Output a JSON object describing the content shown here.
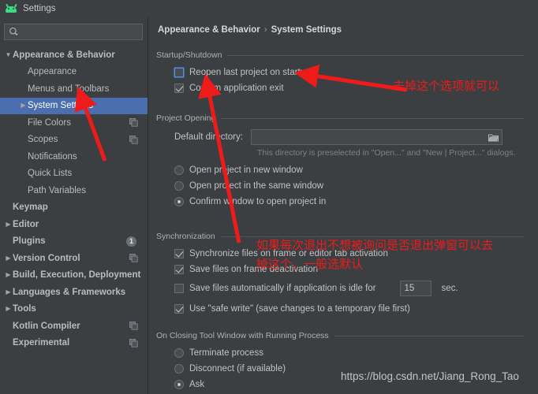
{
  "window": {
    "title": "Settings",
    "app_icon": "android-icon"
  },
  "sidebar": {
    "search": {
      "value": "",
      "placeholder": "",
      "icon": "search-icon"
    },
    "items": [
      {
        "label": "Appearance & Behavior",
        "arrow": "▼",
        "level": 0,
        "bold": true,
        "selected": false,
        "badge": null
      },
      {
        "label": "Appearance",
        "arrow": "",
        "level": 1,
        "bold": false,
        "selected": false,
        "badge": null
      },
      {
        "label": "Menus and Toolbars",
        "arrow": "",
        "level": 1,
        "bold": false,
        "selected": false,
        "badge": null
      },
      {
        "label": "System Settings",
        "arrow": "▶",
        "level": 1,
        "bold": false,
        "selected": true,
        "badge": null
      },
      {
        "label": "File Colors",
        "arrow": "",
        "level": 1,
        "bold": false,
        "selected": false,
        "badge": "copy"
      },
      {
        "label": "Scopes",
        "arrow": "",
        "level": 1,
        "bold": false,
        "selected": false,
        "badge": "copy"
      },
      {
        "label": "Notifications",
        "arrow": "",
        "level": 1,
        "bold": false,
        "selected": false,
        "badge": null
      },
      {
        "label": "Quick Lists",
        "arrow": "",
        "level": 1,
        "bold": false,
        "selected": false,
        "badge": null
      },
      {
        "label": "Path Variables",
        "arrow": "",
        "level": 1,
        "bold": false,
        "selected": false,
        "badge": null
      },
      {
        "label": "Keymap",
        "arrow": "",
        "level": 0,
        "bold": true,
        "selected": false,
        "badge": null
      },
      {
        "label": "Editor",
        "arrow": "▶",
        "level": 0,
        "bold": true,
        "selected": false,
        "badge": null
      },
      {
        "label": "Plugins",
        "arrow": "",
        "level": 0,
        "bold": true,
        "selected": false,
        "badge": "1"
      },
      {
        "label": "Version Control",
        "arrow": "▶",
        "level": 0,
        "bold": true,
        "selected": false,
        "badge": "copy"
      },
      {
        "label": "Build, Execution, Deployment",
        "arrow": "▶",
        "level": 0,
        "bold": true,
        "selected": false,
        "badge": null
      },
      {
        "label": "Languages & Frameworks",
        "arrow": "▶",
        "level": 0,
        "bold": true,
        "selected": false,
        "badge": null
      },
      {
        "label": "Tools",
        "arrow": "▶",
        "level": 0,
        "bold": true,
        "selected": false,
        "badge": null
      },
      {
        "label": "Kotlin Compiler",
        "arrow": "",
        "level": 0,
        "bold": true,
        "selected": false,
        "badge": "copy"
      },
      {
        "label": "Experimental",
        "arrow": "",
        "level": 0,
        "bold": true,
        "selected": false,
        "badge": "copy"
      }
    ]
  },
  "main": {
    "breadcrumb": {
      "parent": "Appearance & Behavior",
      "separator": "›",
      "current": "System Settings"
    },
    "startup_shutdown": {
      "title": "Startup/Shutdown",
      "reopen_last_project": {
        "label": "Reopen last project on startup",
        "checked": false,
        "focused": true
      },
      "confirm_app_exit": {
        "label": "Confirm application exit",
        "checked": true,
        "focused": false
      }
    },
    "project_opening": {
      "title": "Project Opening",
      "default_directory_label": "Default directory:",
      "default_directory_value": "",
      "browse_icon": "folder-icon",
      "hint": "This directory is preselected in \"Open...\" and \"New | Project...\" dialogs.",
      "radios": [
        {
          "label": "Open project in new window",
          "checked": false
        },
        {
          "label": "Open project in the same window",
          "checked": false
        },
        {
          "label": "Confirm window to open project in",
          "checked": true
        }
      ]
    },
    "synchronization": {
      "title": "Synchronization",
      "checkboxes": [
        {
          "label": "Synchronize files on frame or editor tab activation",
          "checked": true
        },
        {
          "label": "Save files on frame deactivation",
          "checked": true
        },
        {
          "label": "Save files automatically if application is idle for",
          "checked": false
        },
        {
          "label": "Use \"safe write\" (save changes to a temporary file first)",
          "checked": true
        }
      ],
      "idle_seconds": "15",
      "sec_label": "sec."
    },
    "closing_tool_window": {
      "title": "On Closing Tool Window with Running Process",
      "radios": [
        {
          "label": "Terminate process",
          "checked": false
        },
        {
          "label": "Disconnect (if available)",
          "checked": false
        },
        {
          "label": "Ask",
          "checked": true
        }
      ]
    }
  },
  "annotations": {
    "color": "#ee1b1b",
    "note_1": "去掉这个选项就可以",
    "note_2_line1": "如果每次退出不想被询问是否退出弹窗可以去",
    "note_2_line2": "掉这个，一般选默认"
  },
  "watermark": "https://blog.csdn.net/Jiang_Rong_Tao"
}
